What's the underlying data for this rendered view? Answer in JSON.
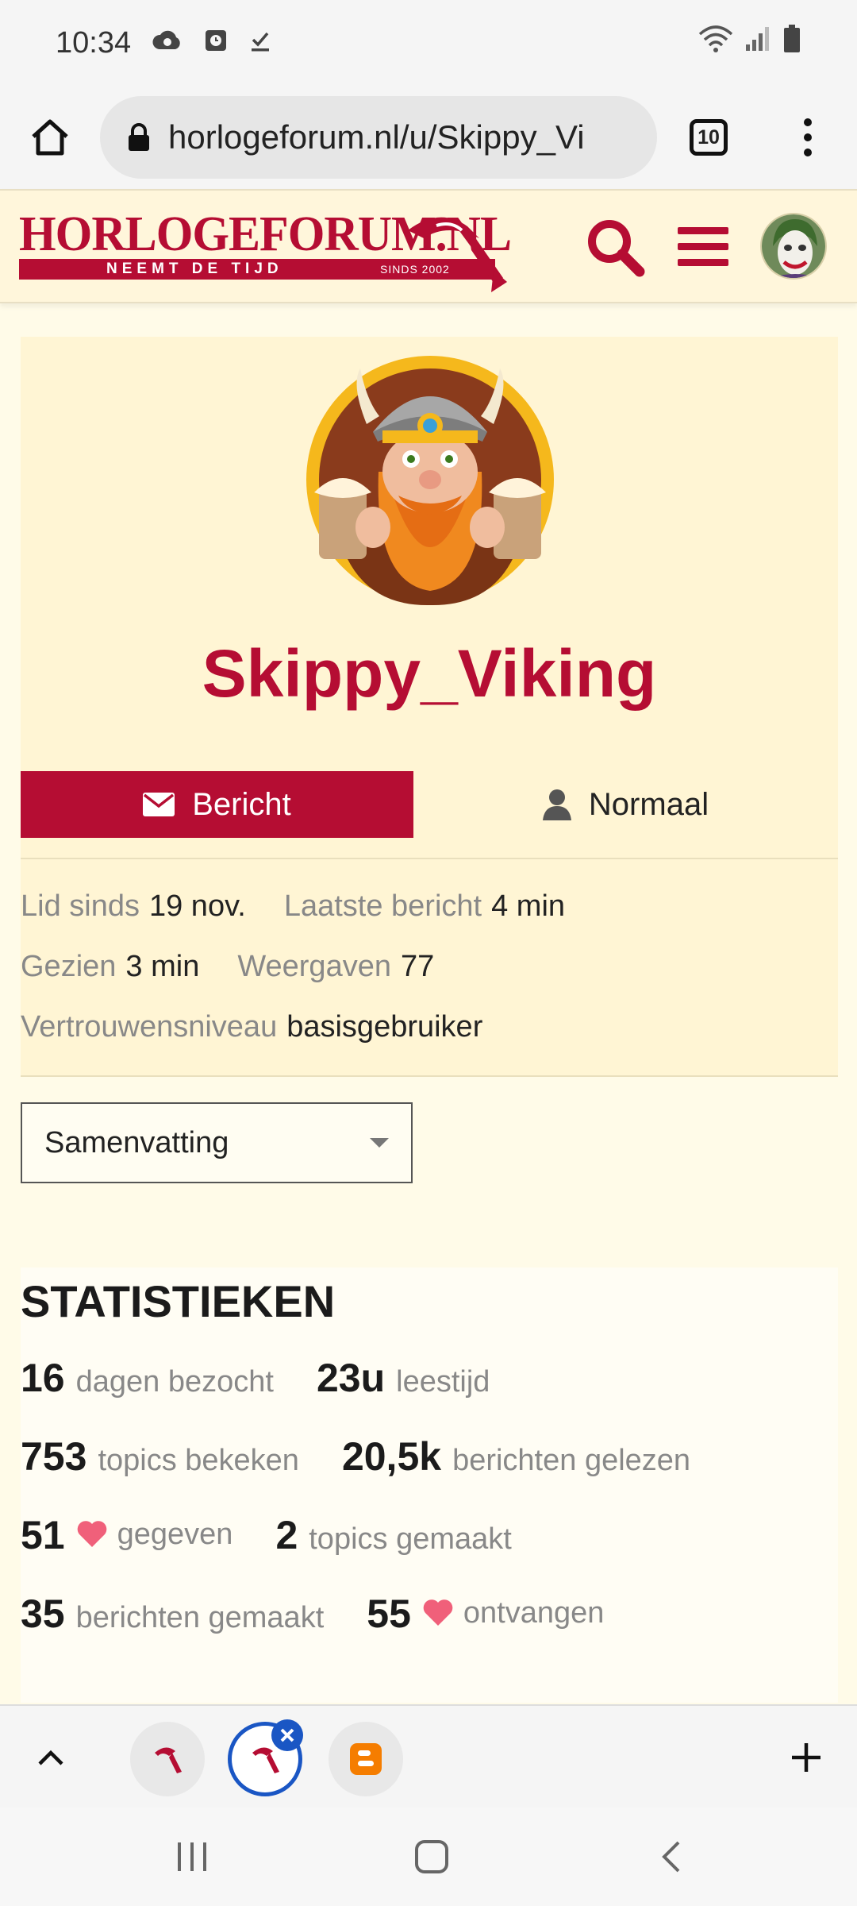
{
  "status_bar": {
    "time": "10:34"
  },
  "browser": {
    "url": "horlogeforum.nl/u/Skippy_Vi",
    "tab_count": "10"
  },
  "site": {
    "logo_text": "HORLOGEFORUM.NL",
    "logo_tagline": "NEEMT DE TIJD",
    "logo_since": "SINDS 2002",
    "brand_color": "#b50d33"
  },
  "profile": {
    "username": "Skippy_Viking",
    "message_label": "Bericht",
    "trust_badge": "Normaal",
    "meta": {
      "member_since_label": "Lid sinds",
      "member_since_value": "19 nov.",
      "last_post_label": "Laatste bericht",
      "last_post_value": "4 min",
      "seen_label": "Gezien",
      "seen_value": "3 min",
      "views_label": "Weergaven",
      "views_value": "77",
      "trust_level_label": "Vertrouwensniveau",
      "trust_level_value": "basisgebruiker"
    }
  },
  "view_select": {
    "selected": "Samenvatting"
  },
  "stats": {
    "title": "STATISTIEKEN",
    "items": [
      {
        "value": "16",
        "label": "dagen bezocht",
        "heart": false
      },
      {
        "value": "23u",
        "label": "leestijd",
        "heart": false
      },
      {
        "value": "753",
        "label": "topics bekeken",
        "heart": false
      },
      {
        "value": "20,5k",
        "label": "berichten gelezen",
        "heart": false
      },
      {
        "value": "51",
        "label": "gegeven",
        "heart": true
      },
      {
        "value": "2",
        "label": "topics gemaakt",
        "heart": false
      },
      {
        "value": "35",
        "label": "berichten gemaakt",
        "heart": false
      },
      {
        "value": "55",
        "label": "ontvangen",
        "heart": true
      }
    ],
    "heart_color": "#f0607a"
  }
}
